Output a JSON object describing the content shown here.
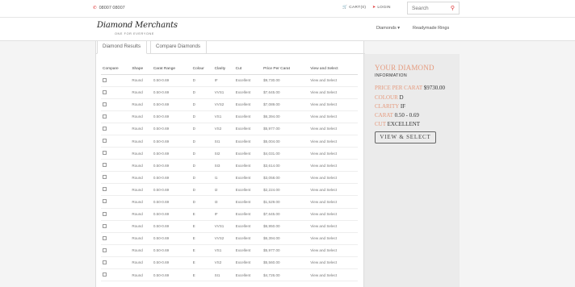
{
  "topbar": {
    "phone": "08007 08007",
    "cart": "CART(0)",
    "login": "LOGIN",
    "search_placeholder": "Search"
  },
  "nav": {
    "logo_text": "Diamond Merchants",
    "logo_tagline": "ONE FOR EVERYONE",
    "diamonds": "Diamonds ▾",
    "rings": "Readymade Rings"
  },
  "tabs": {
    "results": "Diamond Results",
    "compare": "Compare Diamonds"
  },
  "table": {
    "headers": [
      "Compare",
      "Shape",
      "Carat Range",
      "Colour",
      "Clarity",
      "Cut",
      "Price Per Carat",
      "View and Select"
    ],
    "rows": [
      {
        "shape": "Round",
        "carat": "0.50-0.69",
        "colour": "D",
        "clarity": "IF",
        "cut": "Excellent",
        "price": "$9,730.00",
        "action": "View and Select"
      },
      {
        "shape": "Round",
        "carat": "0.50-0.69",
        "colour": "D",
        "clarity": "VVS1",
        "cut": "Excellent",
        "price": "$7,645.00",
        "action": "View and Select"
      },
      {
        "shape": "Round",
        "carat": "0.50-0.69",
        "colour": "D",
        "clarity": "VVS2",
        "cut": "Excellent",
        "price": "$7,089.00",
        "action": "View and Select"
      },
      {
        "shape": "Round",
        "carat": "0.50-0.69",
        "colour": "D",
        "clarity": "VS1",
        "cut": "Excellent",
        "price": "$6,394.00",
        "action": "View and Select"
      },
      {
        "shape": "Round",
        "carat": "0.50-0.69",
        "colour": "D",
        "clarity": "VS2",
        "cut": "Excellent",
        "price": "$5,977.00",
        "action": "View and Select"
      },
      {
        "shape": "Round",
        "carat": "0.50-0.69",
        "colour": "D",
        "clarity": "SI1",
        "cut": "Excellent",
        "price": "$5,004.00",
        "action": "View and Select"
      },
      {
        "shape": "Round",
        "carat": "0.50-0.69",
        "colour": "D",
        "clarity": "SI2",
        "cut": "Excellent",
        "price": "$4,031.00",
        "action": "View and Select"
      },
      {
        "shape": "Round",
        "carat": "0.50-0.69",
        "colour": "D",
        "clarity": "SI3",
        "cut": "Excellent",
        "price": "$3,614.00",
        "action": "View and Select"
      },
      {
        "shape": "Round",
        "carat": "0.50-0.69",
        "colour": "D",
        "clarity": "I1",
        "cut": "Excellent",
        "price": "$3,058.00",
        "action": "View and Select"
      },
      {
        "shape": "Round",
        "carat": "0.50-0.69",
        "colour": "D",
        "clarity": "I2",
        "cut": "Excellent",
        "price": "$2,224.00",
        "action": "View and Select"
      },
      {
        "shape": "Round",
        "carat": "0.50-0.69",
        "colour": "D",
        "clarity": "I3",
        "cut": "Excellent",
        "price": "$1,529.00",
        "action": "View and Select"
      },
      {
        "shape": "Round",
        "carat": "0.50-0.69",
        "colour": "E",
        "clarity": "IF",
        "cut": "Excellent",
        "price": "$7,645.00",
        "action": "View and Select"
      },
      {
        "shape": "Round",
        "carat": "0.50-0.69",
        "colour": "E",
        "clarity": "VVS1",
        "cut": "Excellent",
        "price": "$6,950.00",
        "action": "View and Select"
      },
      {
        "shape": "Round",
        "carat": "0.50-0.69",
        "colour": "E",
        "clarity": "VVS2",
        "cut": "Excellent",
        "price": "$6,394.00",
        "action": "View and Select"
      },
      {
        "shape": "Round",
        "carat": "0.50-0.69",
        "colour": "E",
        "clarity": "VS1",
        "cut": "Excellent",
        "price": "$5,977.00",
        "action": "View and Select"
      },
      {
        "shape": "Round",
        "carat": "0.50-0.69",
        "colour": "E",
        "clarity": "VS2",
        "cut": "Excellent",
        "price": "$5,560.00",
        "action": "View and Select"
      },
      {
        "shape": "Round",
        "carat": "0.50-0.69",
        "colour": "E",
        "clarity": "SI1",
        "cut": "Excellent",
        "price": "$4,726.00",
        "action": "View and Select"
      }
    ]
  },
  "side": {
    "title": "YOUR DIAMOND",
    "subtitle": "INFORMATION",
    "price_label": "PRICE PER CARAT",
    "price_value": "$9730.00",
    "colour_label": "COLOUR",
    "colour_value": "D",
    "clarity_label": "CLARITY",
    "clarity_value": "IF",
    "carat_label": "CARAT",
    "carat_value": "0.50 - 0.69",
    "cut_label": "CUT",
    "cut_value": "EXCELLENT",
    "button": "VIEW & SELECT"
  },
  "colors": {
    "accent": "#e59a7d",
    "icon_red": "#dd3333"
  }
}
